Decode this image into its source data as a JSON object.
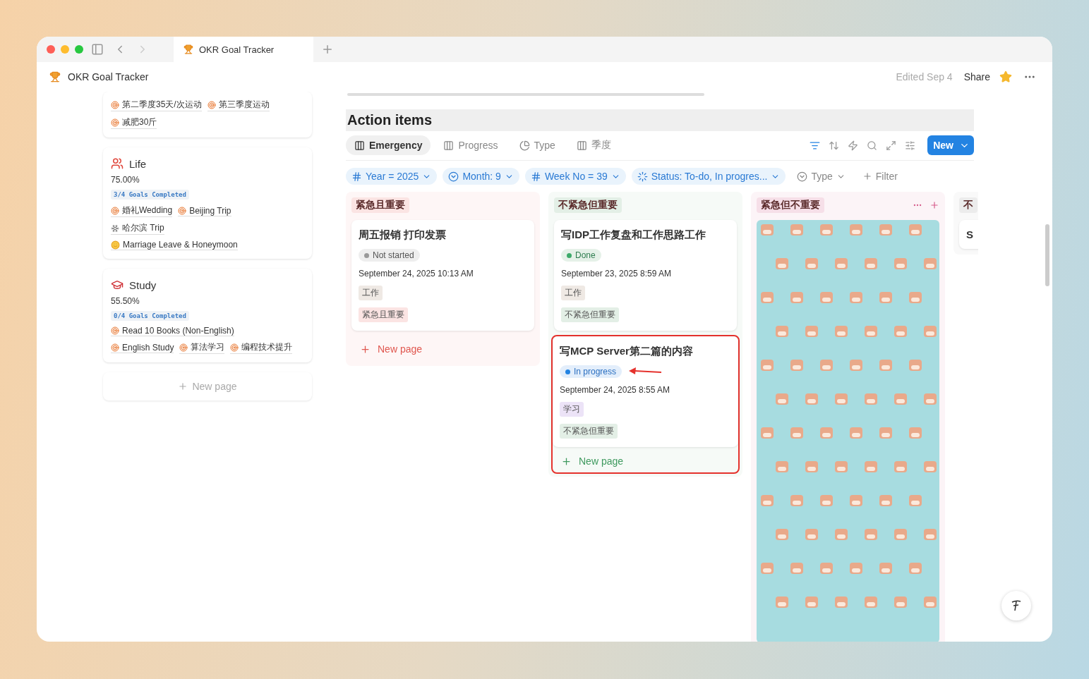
{
  "browser_tab": {
    "title": "OKR Goal Tracker",
    "selected": true
  },
  "header": {
    "title": "OKR Goal Tracker",
    "edited": "Edited Sep 4",
    "share": "Share",
    "starred": true
  },
  "goals": [
    {
      "lines": [
        [
          {
            "kind": "goal",
            "label": "第二季度35天/次运动"
          },
          {
            "kind": "goal",
            "label": "第三季度运动"
          }
        ],
        [
          {
            "kind": "goal",
            "label": "减肥30斤"
          }
        ]
      ]
    },
    {
      "kind": "people",
      "title": "Life",
      "percent": "75.00%",
      "badge": "3/4 Goals Completed",
      "lines": [
        [
          {
            "kind": "goal",
            "label": "婚礼Wedding"
          },
          {
            "kind": "goal",
            "label": "Beijing Trip"
          }
        ],
        [
          {
            "kind": "snowman",
            "label": "哈尔滨 Trip"
          }
        ],
        [
          {
            "kind": "smile",
            "label": "Marriage Leave & Honeymoon"
          }
        ]
      ]
    },
    {
      "kind": "cap",
      "title": "Study",
      "percent": "55.50%",
      "badge": "0/4 Goals Completed",
      "lines": [
        [
          {
            "kind": "goal",
            "label": "Read 10 Books (Non-English)"
          }
        ],
        [
          {
            "kind": "goal",
            "label": "English Study"
          },
          {
            "kind": "goal",
            "label": "算法学习"
          },
          {
            "kind": "goal",
            "label": "编程技术提升"
          }
        ]
      ]
    }
  ],
  "goals_new_page": "New page",
  "section_title": "Action items",
  "views": [
    {
      "kind": "board",
      "label": "Emergency",
      "selected": true
    },
    {
      "kind": "board",
      "label": "Progress",
      "selected": false
    },
    {
      "kind": "chart",
      "label": "Type",
      "selected": false
    },
    {
      "kind": "board",
      "label": "季度",
      "selected": false
    }
  ],
  "new_button": "New",
  "filters": [
    {
      "kind": "number",
      "label": "Year = 2025",
      "active": true
    },
    {
      "kind": "select",
      "label": "Month: 9",
      "active": true
    },
    {
      "kind": "number",
      "label": "Week No = 39",
      "active": true
    },
    {
      "kind": "status",
      "label": "Status: To-do, In progres...",
      "active": true
    },
    {
      "kind": "select",
      "label": "Type",
      "active": false
    }
  ],
  "add_filter": "Filter",
  "columns": [
    {
      "label": "紧急且重要",
      "color": "#fbe4e3",
      "new_page": "New page",
      "cards": [
        {
          "kind": "task",
          "title": "周五报销 打印发票",
          "status": {
            "kind": "not_started",
            "label": "Not started"
          },
          "date": "September 24, 2025 10:13 AM",
          "tags": [
            {
              "label": "工作",
              "color": "#efe9e4"
            },
            {
              "label": "紧急且重要",
              "color": "#fbe4e3"
            }
          ]
        }
      ]
    },
    {
      "label": "不紧急但重要",
      "color": "#e3efe6",
      "annotation": true,
      "new_page": "New page",
      "cards": [
        {
          "kind": "task",
          "title": "写IDP工作复盘和工作思路工作",
          "status": {
            "kind": "done",
            "label": "Done"
          },
          "date": "September 23, 2025 8:59 AM",
          "tags": [
            {
              "label": "工作",
              "color": "#efe9e4"
            },
            {
              "label": "不紧急但重要",
              "color": "#e3efe6"
            }
          ]
        },
        {
          "kind": "task",
          "title": "写MCP Server第二篇的内容",
          "status": {
            "kind": "in_progress",
            "label": "In progress"
          },
          "date": "September 24, 2025 8:55 AM",
          "tags": [
            {
              "label": "学习",
              "color": "#ece3f7"
            },
            {
              "label": "不紧急但重要",
              "color": "#e3efe6"
            }
          ]
        }
      ]
    },
    {
      "label": "紧急但不重要",
      "color": "#f6dfe8"
    },
    {
      "label": "不",
      "color": "#ececec",
      "cards": [
        {
          "kind": "task",
          "title": "S"
        }
      ]
    }
  ]
}
